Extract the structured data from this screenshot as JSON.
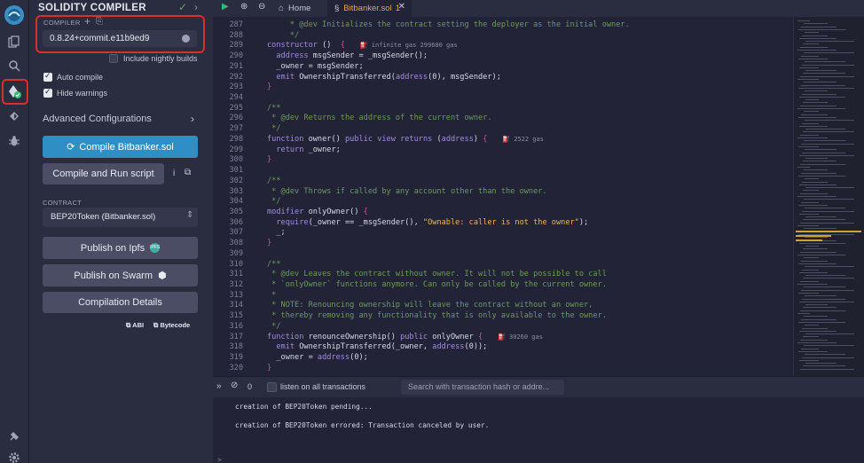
{
  "panel": {
    "title": "SOLIDITY COMPILER",
    "compiler_label": "COMPILER",
    "compiler_version": "0.8.24+commit.e11b9ed9",
    "include_nightly": "Include nightly builds",
    "auto_compile": "Auto compile",
    "hide_warnings": "Hide warnings",
    "advanced": "Advanced Configurations",
    "compile_button": "Compile Bitbanker.sol",
    "compile_run_button": "Compile and Run script",
    "contract_label": "CONTRACT",
    "contract_value": "BEP20Token (Bitbanker.sol)",
    "publish_ipfs": "Publish on Ipfs",
    "ipfs_badge": "IPFS",
    "publish_swarm": "Publish on Swarm",
    "compilation_details": "Compilation Details",
    "abi": "ABI",
    "bytecode": "Bytecode"
  },
  "tabs": {
    "home": "Home",
    "file": "Bitbanker.sol",
    "file_badge": "1"
  },
  "editor": {
    "lines": [
      {
        "n": "287",
        "parts": [
          {
            "t": "     * @dev Initializes the contract setting the deployer as the initial owner.",
            "c": "c-com"
          }
        ]
      },
      {
        "n": "288",
        "parts": [
          {
            "t": "     */",
            "c": "c-com"
          }
        ]
      },
      {
        "n": "289",
        "parts": [
          {
            "t": "constructor",
            "c": "c-kw"
          },
          {
            "t": " () ",
            "c": "c-plain"
          },
          {
            "t": " {",
            "c": "c-punc"
          },
          {
            "t": "    ⛽ infinite gas 299600 gas",
            "c": "c-gas"
          }
        ]
      },
      {
        "n": "290",
        "parts": [
          {
            "t": "  address",
            "c": "c-kw"
          },
          {
            "t": " msgSender = _msgSender();",
            "c": "c-plain"
          }
        ]
      },
      {
        "n": "291",
        "parts": [
          {
            "t": "  _owner = msgSender;",
            "c": "c-plain"
          }
        ]
      },
      {
        "n": "292",
        "parts": [
          {
            "t": "  emit",
            "c": "c-kw"
          },
          {
            "t": " OwnershipTransferred(",
            "c": "c-plain"
          },
          {
            "t": "address",
            "c": "c-kw"
          },
          {
            "t": "(0), msgSender);",
            "c": "c-plain"
          }
        ]
      },
      {
        "n": "293",
        "parts": [
          {
            "t": "}",
            "c": "c-punc"
          }
        ]
      },
      {
        "n": "294",
        "parts": []
      },
      {
        "n": "295",
        "parts": [
          {
            "t": "/**",
            "c": "c-com"
          }
        ]
      },
      {
        "n": "296",
        "parts": [
          {
            "t": " * @dev Returns the address of the current owner.",
            "c": "c-com"
          }
        ]
      },
      {
        "n": "297",
        "parts": [
          {
            "t": " */",
            "c": "c-com"
          }
        ]
      },
      {
        "n": "298",
        "parts": [
          {
            "t": "function",
            "c": "c-kw"
          },
          {
            "t": " owner() ",
            "c": "c-plain"
          },
          {
            "t": "public view returns",
            "c": "c-kw"
          },
          {
            "t": " (",
            "c": "c-plain"
          },
          {
            "t": "address",
            "c": "c-kw"
          },
          {
            "t": ") ",
            "c": "c-plain"
          },
          {
            "t": "{",
            "c": "c-punc"
          },
          {
            "t": "    ⛽ 2522 gas",
            "c": "c-gas"
          }
        ]
      },
      {
        "n": "299",
        "parts": [
          {
            "t": "  return",
            "c": "c-kw"
          },
          {
            "t": " _owner;",
            "c": "c-plain"
          }
        ]
      },
      {
        "n": "300",
        "parts": [
          {
            "t": "}",
            "c": "c-punc"
          }
        ]
      },
      {
        "n": "301",
        "parts": []
      },
      {
        "n": "302",
        "parts": [
          {
            "t": "/**",
            "c": "c-com"
          }
        ]
      },
      {
        "n": "303",
        "parts": [
          {
            "t": " * @dev Throws if called by any account other than the owner.",
            "c": "c-com"
          }
        ]
      },
      {
        "n": "304",
        "parts": [
          {
            "t": " */",
            "c": "c-com"
          }
        ]
      },
      {
        "n": "305",
        "parts": [
          {
            "t": "modifier",
            "c": "c-kw"
          },
          {
            "t": " onlyOwner() ",
            "c": "c-plain"
          },
          {
            "t": "{",
            "c": "c-punc"
          }
        ]
      },
      {
        "n": "306",
        "parts": [
          {
            "t": "  require",
            "c": "c-kw"
          },
          {
            "t": "(_owner == _msgSender(), ",
            "c": "c-plain"
          },
          {
            "t": "\"Ownable: caller is not the owner\"",
            "c": "c-str"
          },
          {
            "t": ");",
            "c": "c-plain"
          }
        ]
      },
      {
        "n": "307",
        "parts": [
          {
            "t": "  _;",
            "c": "c-plain"
          }
        ]
      },
      {
        "n": "308",
        "parts": [
          {
            "t": "}",
            "c": "c-punc"
          }
        ]
      },
      {
        "n": "309",
        "parts": []
      },
      {
        "n": "310",
        "parts": [
          {
            "t": "/**",
            "c": "c-com"
          }
        ]
      },
      {
        "n": "311",
        "parts": [
          {
            "t": " * @dev Leaves the contract without owner. It will not be possible to call",
            "c": "c-com"
          }
        ]
      },
      {
        "n": "312",
        "parts": [
          {
            "t": " * `onlyOwner` functions anymore. Can only be called by the current owner.",
            "c": "c-com"
          }
        ]
      },
      {
        "n": "313",
        "parts": [
          {
            "t": " *",
            "c": "c-com"
          }
        ]
      },
      {
        "n": "314",
        "parts": [
          {
            "t": " * NOTE: Renouncing ownership will leave the contract without an owner,",
            "c": "c-com"
          }
        ]
      },
      {
        "n": "315",
        "parts": [
          {
            "t": " * thereby removing any functionality that is only available to the owner.",
            "c": "c-com"
          }
        ]
      },
      {
        "n": "316",
        "parts": [
          {
            "t": " */",
            "c": "c-com"
          }
        ]
      },
      {
        "n": "317",
        "parts": [
          {
            "t": "function",
            "c": "c-kw"
          },
          {
            "t": " renounceOwnership() ",
            "c": "c-plain"
          },
          {
            "t": "public",
            "c": "c-kw"
          },
          {
            "t": " onlyOwner ",
            "c": "c-plain"
          },
          {
            "t": "{",
            "c": "c-punc"
          },
          {
            "t": "    ⛽ 30260 gas",
            "c": "c-gas"
          }
        ]
      },
      {
        "n": "318",
        "parts": [
          {
            "t": "  emit",
            "c": "c-kw"
          },
          {
            "t": " OwnershipTransferred(_owner, ",
            "c": "c-plain"
          },
          {
            "t": "address",
            "c": "c-kw"
          },
          {
            "t": "(0));",
            "c": "c-plain"
          }
        ]
      },
      {
        "n": "319",
        "parts": [
          {
            "t": "  _owner = ",
            "c": "c-plain"
          },
          {
            "t": "address",
            "c": "c-kw"
          },
          {
            "t": "(0);",
            "c": "c-plain"
          }
        ]
      },
      {
        "n": "320",
        "parts": [
          {
            "t": "}",
            "c": "c-punc"
          }
        ]
      }
    ]
  },
  "terminal": {
    "count": "0",
    "listen_label": "listen on all transactions",
    "search_placeholder": "Search with transaction hash or addre...",
    "line1": "creation of BEP20Token pending...",
    "line2": "creation of BEP20Token errored: Transaction canceled by user.",
    "prompt": ">"
  },
  "colors": {
    "accent": "#2f8fc4",
    "highlight": "#d9302a",
    "success": "#2fbf71"
  }
}
